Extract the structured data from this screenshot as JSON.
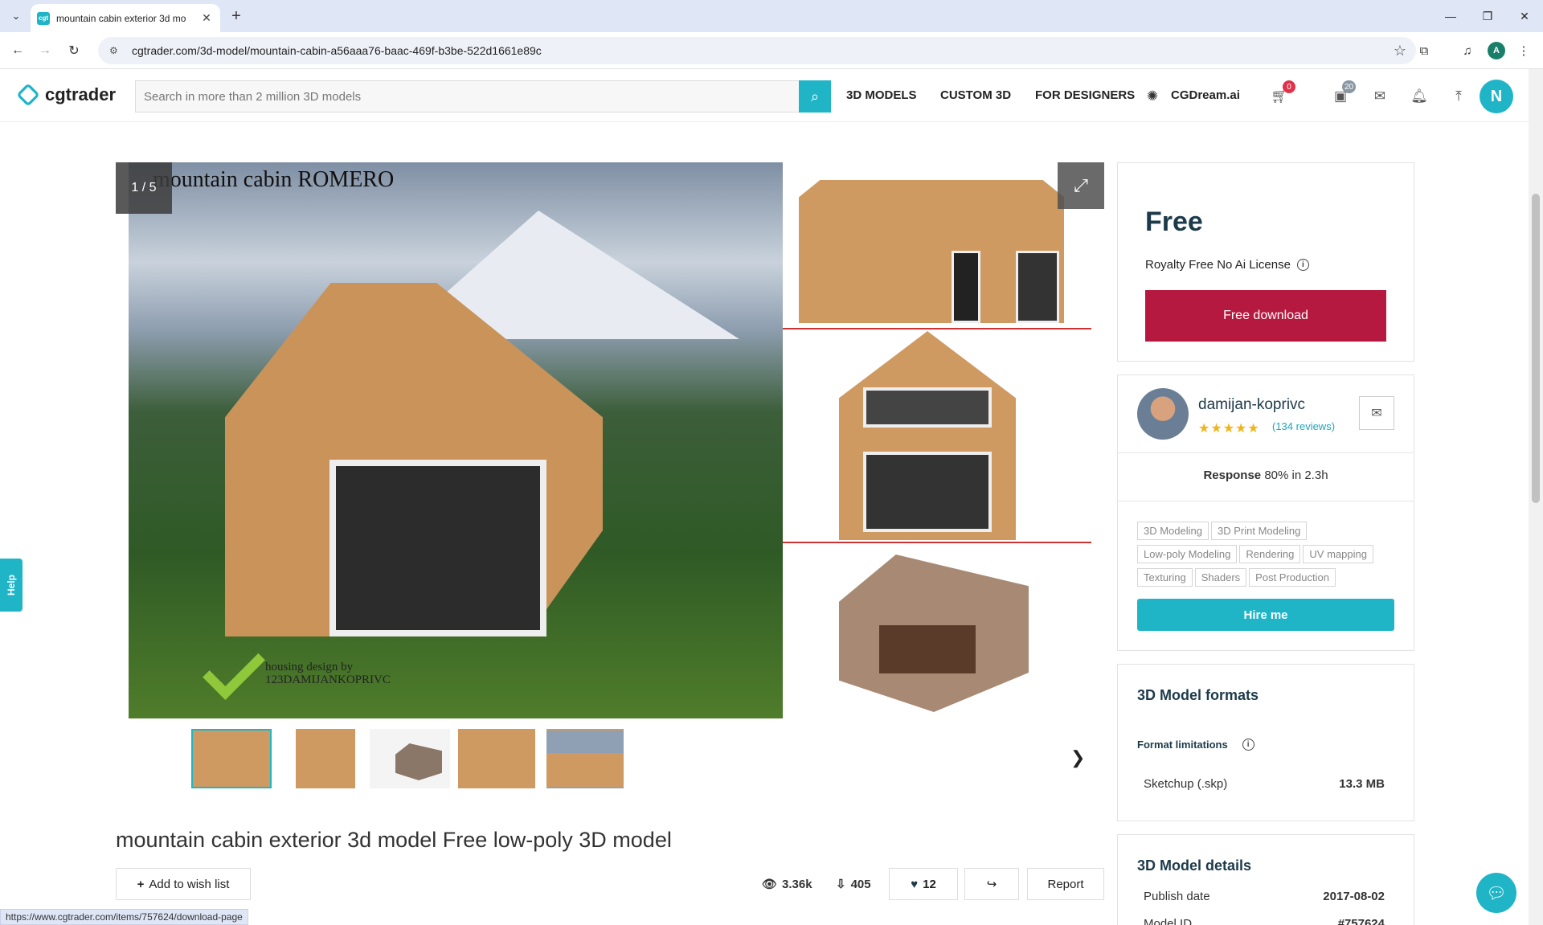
{
  "browser": {
    "tab_title": "mountain cabin exterior 3d mo",
    "tab_favicon": "cgt",
    "url": "cgtrader.com/3d-model/mountain-cabin-a56aaa76-baac-469f-b3be-522d1661e89c",
    "profile_initial": "A",
    "status_url": "https://www.cgtrader.com/items/757624/download-page"
  },
  "header": {
    "logo": "cgtrader",
    "search_placeholder": "Search in more than 2 million 3D models",
    "nav": [
      "3D MODELS",
      "CUSTOM 3D",
      "FOR DESIGNERS",
      "CGDream.ai"
    ],
    "cart_count": "0",
    "notifications_count": "20",
    "user_initial": "N"
  },
  "gallery": {
    "counter": "1 / 5",
    "image_title": "mountain cabin ROMERO",
    "watermark_line1": "housing design by",
    "watermark_line2": "123DAMIJANKOPRIVC",
    "thumbnail_count": 5
  },
  "model": {
    "title": "mountain cabin exterior 3d model Free low-poly 3D model",
    "wishlist_label": "Add to wish list",
    "views": "3.36k",
    "downloads": "405",
    "likes": "12",
    "report_label": "Report"
  },
  "purchase": {
    "price": "Free",
    "license": "Royalty Free No Ai License",
    "download_label": "Free download",
    "accent": "#b5193f"
  },
  "author": {
    "name": "damijan-koprivc",
    "stars": "★★★★★",
    "reviews": "(134 reviews)",
    "response_label": "Response",
    "response_value": "80% in 2.3h",
    "tags": [
      "3D Modeling",
      "3D Print Modeling",
      "Low-poly Modeling",
      "Rendering",
      "UV mapping",
      "Texturing",
      "Shaders",
      "Post Production"
    ],
    "hire_label": "Hire me"
  },
  "formats": {
    "title": "3D Model formats",
    "limitations_label": "Format limitations",
    "items": [
      {
        "name": "Sketchup (.skp)",
        "size": "13.3 MB"
      }
    ]
  },
  "details": {
    "title": "3D Model details",
    "publish_label": "Publish date",
    "publish_value": "2017-08-02",
    "id_label": "Model ID",
    "id_value": "#757624"
  },
  "help_label": "Help",
  "brand_color": "#1fb5c7"
}
